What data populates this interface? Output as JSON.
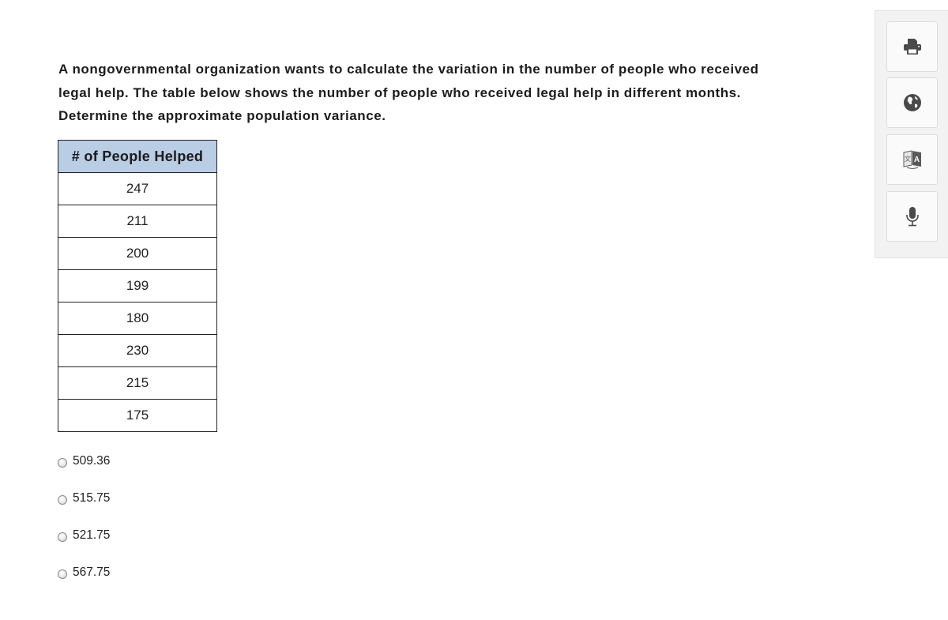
{
  "question": {
    "lines": [
      "A nongovernmental organization wants to calculate the variation in the number of people who received",
      "legal help. The table below shows the number of people who received legal help in different months.",
      "Determine the approximate population variance."
    ]
  },
  "table": {
    "header": "# of People Helped",
    "header_color": "#b9cde5",
    "rows": [
      "247",
      "211",
      "200",
      "199",
      "180",
      "230",
      "215",
      "175"
    ]
  },
  "options": [
    {
      "label": "509.36",
      "selected": false
    },
    {
      "label": "515.75",
      "selected": false
    },
    {
      "label": "521.75",
      "selected": false
    },
    {
      "label": "567.75",
      "selected": false
    }
  ],
  "toolbar": {
    "buttons": [
      {
        "name": "print",
        "icon": "printer-icon"
      },
      {
        "name": "globe",
        "icon": "globe-icon"
      },
      {
        "name": "translate",
        "icon": "translate-icon"
      },
      {
        "name": "microphone",
        "icon": "microphone-icon"
      }
    ]
  }
}
